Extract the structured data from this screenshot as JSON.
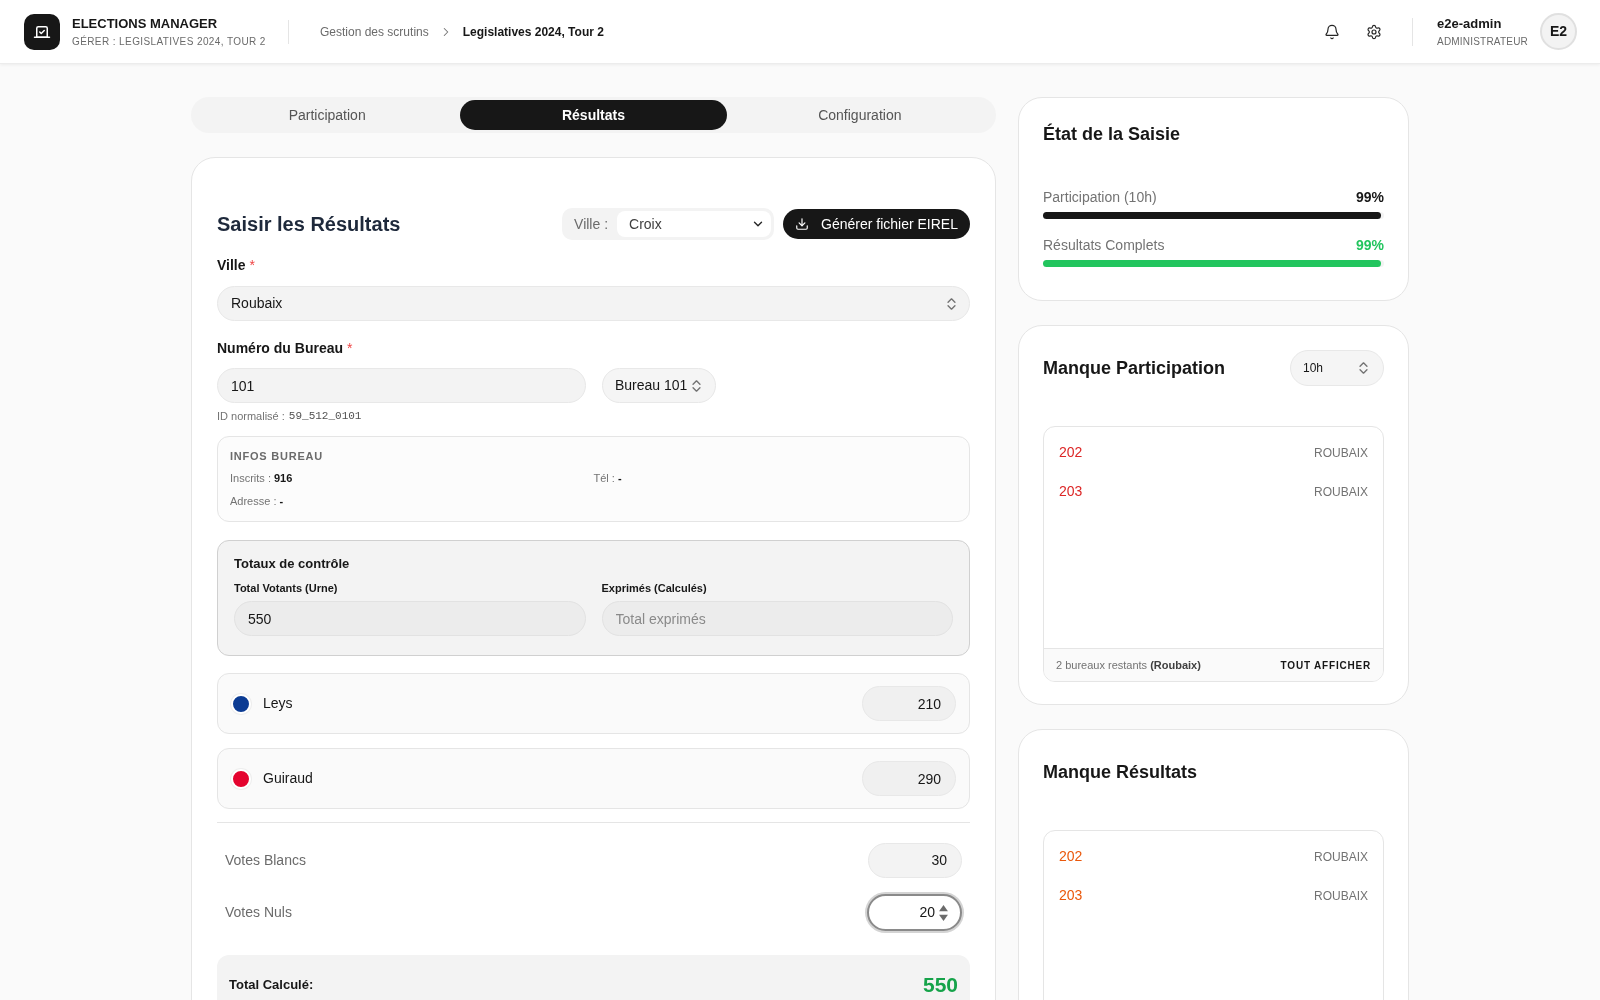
{
  "header": {
    "app_title": "ELECTIONS MANAGER",
    "app_subtitle": "GÉRER : LEGISLATIVES 2024, TOUR 2",
    "breadcrumb": [
      {
        "label": "Gestion des scrutins",
        "current": false
      },
      {
        "label": "Legislatives 2024, Tour 2",
        "current": true
      }
    ],
    "user": {
      "name": "e2e-admin",
      "role": "ADMINISTRATEUR",
      "initials": "E2"
    }
  },
  "tabs": [
    {
      "label": "Participation",
      "selected": false
    },
    {
      "label": "Résultats",
      "selected": true
    },
    {
      "label": "Configuration",
      "selected": false
    }
  ],
  "results_form": {
    "title": "Saisir les Résultats",
    "city_filter": {
      "label": "Ville :",
      "value": "Croix"
    },
    "export_button": "Générer fichier EIREL",
    "city_field": {
      "label": "Ville",
      "required_mark": "*",
      "value": "Roubaix"
    },
    "bureau_field": {
      "label": "Numéro du Bureau",
      "required_mark": "*",
      "value": "101",
      "select_value": "Bureau 101",
      "normalized_id_label": "ID normalisé :",
      "normalized_id": "59_512_0101"
    },
    "bureau_info": {
      "title": "INFOS BUREAU",
      "items": [
        {
          "label": "Inscrits :",
          "value": "916"
        },
        {
          "label": "Tél :",
          "value": "-"
        },
        {
          "label": "Adresse :",
          "value": "-"
        }
      ]
    },
    "control_totals": {
      "title": "Totaux de contrôle",
      "fields": [
        {
          "label": "Total Votants (Urne)",
          "value": "550"
        },
        {
          "label": "Exprimés (Calculés)",
          "placeholder": "Total exprimés"
        }
      ]
    },
    "candidates": [
      {
        "name": "Leys",
        "color": "#0b3b93",
        "votes": "210"
      },
      {
        "name": "Guiraud",
        "color": "#e4032e",
        "votes": "290"
      }
    ],
    "other_votes": [
      {
        "label": "Votes Blancs",
        "value": "30",
        "focused": false
      },
      {
        "label": "Votes Nuls",
        "value": "20",
        "focused": true
      }
    ],
    "total": {
      "label": "Total Calculé:",
      "value": "550"
    }
  },
  "entry_status": {
    "title": "État de la Saisie",
    "progress": [
      {
        "label": "Participation (10h)",
        "reading": "99%",
        "level": 0.99,
        "color": "#171717"
      },
      {
        "label": "Résultats Complets",
        "reading": "99%",
        "level": 0.99,
        "color": "#22c55e"
      }
    ]
  },
  "missing_panels": [
    {
      "title": "Manque Participation",
      "color": "#dc2626",
      "hour_select": "10h",
      "items": [
        {
          "number": "202",
          "city": "ROUBAIX"
        },
        {
          "number": "203",
          "city": "ROUBAIX"
        }
      ],
      "footer": {
        "summary": "2 bureaux restants **(Roubaix)**",
        "action": "TOUT AFFICHER"
      }
    },
    {
      "title": "Manque Résultats",
      "color": "#ea580c",
      "items": [
        {
          "number": "202",
          "city": "ROUBAIX"
        },
        {
          "number": "203",
          "city": "ROUBAIX"
        }
      ]
    }
  ]
}
